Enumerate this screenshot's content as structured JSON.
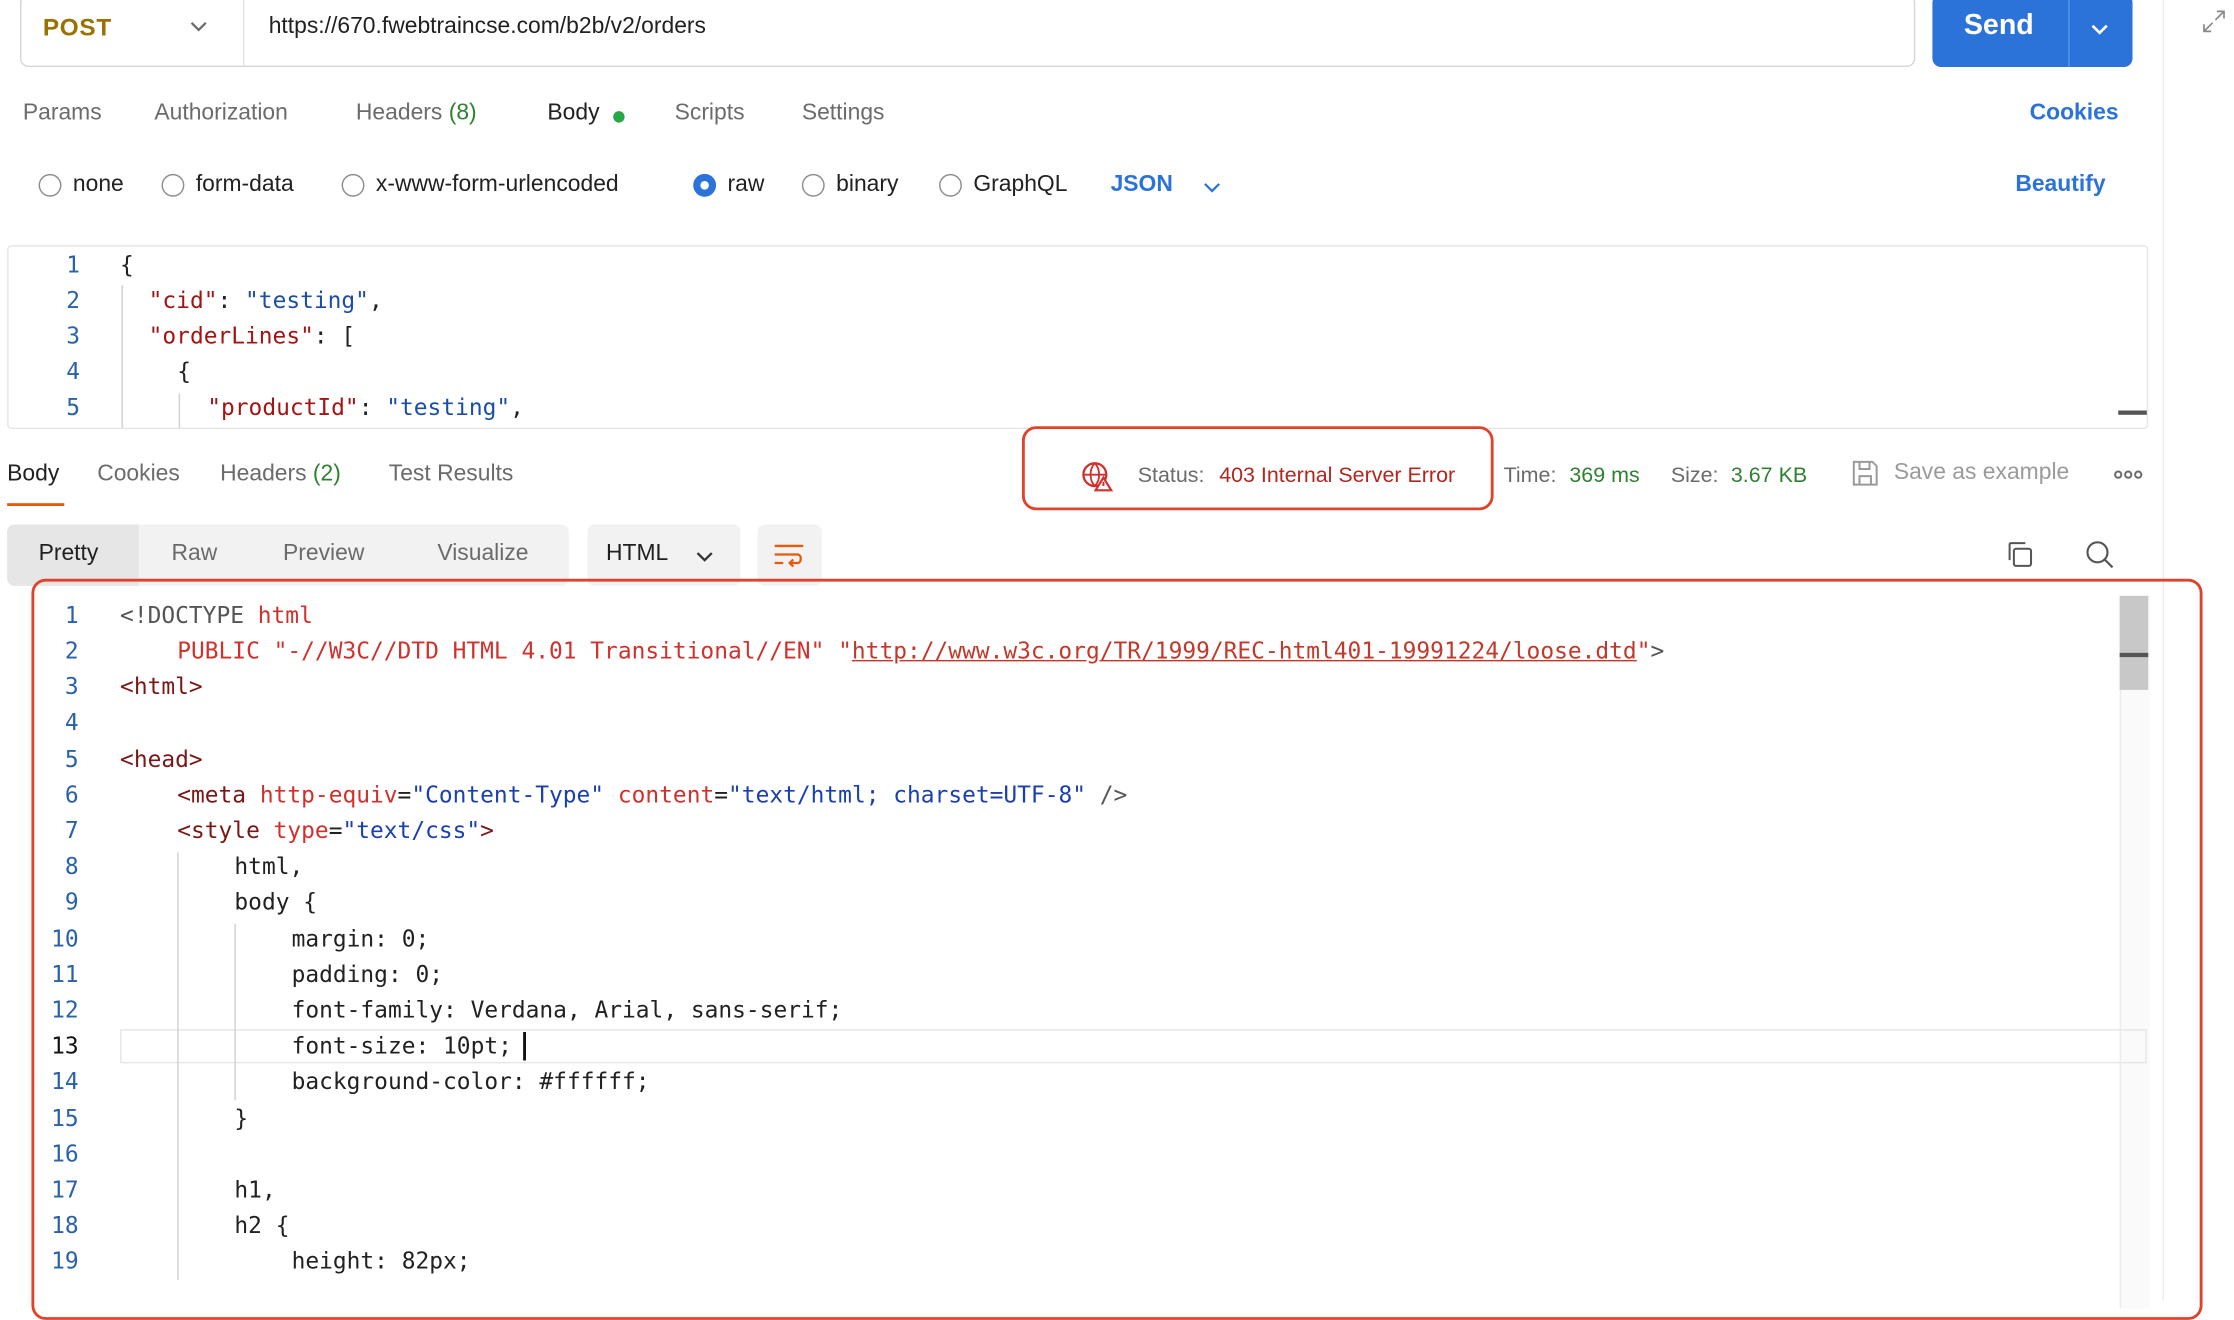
{
  "request": {
    "method": "POST",
    "url": "https://670.fwebtraincse.com/b2b/v2/orders",
    "send_label": "Send"
  },
  "request_tabs": [
    {
      "label": "Params"
    },
    {
      "label": "Authorization"
    },
    {
      "label": "Headers",
      "count": "(8)"
    },
    {
      "label": "Body"
    },
    {
      "label": "Scripts"
    },
    {
      "label": "Settings"
    }
  ],
  "cookies_label": "Cookies",
  "body_types": [
    {
      "label": "none"
    },
    {
      "label": "form-data"
    },
    {
      "label": "x-www-form-urlencoded"
    },
    {
      "label": "raw"
    },
    {
      "label": "binary"
    },
    {
      "label": "GraphQL"
    }
  ],
  "body_format": "JSON",
  "beautify_label": "Beautify",
  "request_body": {
    "line_numbers": [
      "1",
      "2",
      "3",
      "4",
      "5"
    ],
    "lines": {
      "l1": "{",
      "k2": "\"cid\"",
      "v2": "\"testing\"",
      "k3": "\"orderLines\"",
      "v3": "[",
      "l4": "{",
      "k5": "\"productId\"",
      "v5": "\"testing\""
    }
  },
  "response_tabs": [
    {
      "label": "Body"
    },
    {
      "label": "Cookies"
    },
    {
      "label": "Headers",
      "count": "(2)"
    },
    {
      "label": "Test Results"
    }
  ],
  "response_meta": {
    "status_label": "Status:",
    "status_value": "403 Internal Server Error",
    "time_label": "Time:",
    "time_value": "369 ms",
    "size_label": "Size:",
    "size_value": "3.67 KB",
    "save_label": "Save as example"
  },
  "view_tabs": [
    {
      "label": "Pretty"
    },
    {
      "label": "Raw"
    },
    {
      "label": "Preview"
    },
    {
      "label": "Visualize"
    }
  ],
  "response_format": "HTML",
  "response_body": {
    "line_numbers": [
      "1",
      "2",
      "3",
      "4",
      "5",
      "6",
      "7",
      "8",
      "9",
      "10",
      "11",
      "12",
      "13",
      "14",
      "15",
      "16",
      "17",
      "18",
      "19"
    ],
    "l1a": "<!DOCTYPE",
    "l1b": "html",
    "l2a": "PUBLIC",
    "l2b": "\"-//W3C//DTD HTML 4.01 Transitional//EN\"",
    "l2c": "\"",
    "l2d": "http://www.w3c.org/TR/1999/REC-html401-19991224/loose.dtd",
    "l2e": "\"",
    "l2f": ">",
    "l3": "<html>",
    "l5": "<head>",
    "l6a": "<meta",
    "l6b": "http-equiv",
    "l6c": "=",
    "l6d": "\"Content-Type\"",
    "l6e": "content",
    "l6f": "=",
    "l6g": "\"text/html; charset=UTF-8\"",
    "l6h": "/>",
    "l7a": "<style",
    "l7b": "type",
    "l7c": "=",
    "l7d": "\"text/css\"",
    "l7e": ">",
    "l8": "html,",
    "l9": "body {",
    "l10": "margin: 0;",
    "l11": "padding: 0;",
    "l12": "font-family: Verdana, Arial, sans-serif;",
    "l13": "font-size: 10pt;",
    "l14": "background-color: #ffffff;",
    "l15": "}",
    "l17": "h1,",
    "l18": "h2 {",
    "l19": "height: 82px;"
  }
}
